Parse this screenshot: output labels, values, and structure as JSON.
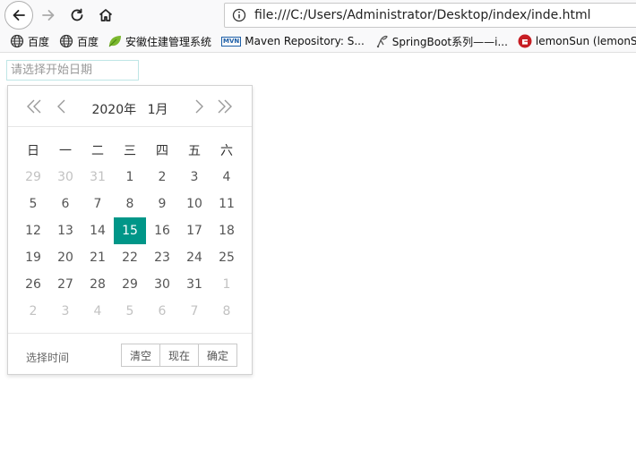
{
  "browser": {
    "url": "file:///C:/Users/Administrator/Desktop/index/inde.html"
  },
  "bookmarks": [
    {
      "label": "百度",
      "icon": "globe-icon"
    },
    {
      "label": "百度",
      "icon": "globe-icon"
    },
    {
      "label": "安徽住建管理系统",
      "icon": "leaf-icon"
    },
    {
      "label": "Maven Repository: S...",
      "icon": "mvn-icon",
      "badge": "MVN"
    },
    {
      "label": "SpringBoot系列——i...",
      "icon": "spring-icon"
    },
    {
      "label": "lemonSun (lemonSun",
      "icon": "gitee-icon"
    }
  ],
  "date_input": {
    "placeholder": "请选择开始日期"
  },
  "datepicker": {
    "year": "2020年",
    "month": "1月",
    "weekdays": [
      "日",
      "一",
      "二",
      "三",
      "四",
      "五",
      "六"
    ],
    "weeks": [
      [
        {
          "d": "29",
          "o": true
        },
        {
          "d": "30",
          "o": true
        },
        {
          "d": "31",
          "o": true
        },
        {
          "d": "1"
        },
        {
          "d": "2"
        },
        {
          "d": "3"
        },
        {
          "d": "4"
        }
      ],
      [
        {
          "d": "5"
        },
        {
          "d": "6"
        },
        {
          "d": "7"
        },
        {
          "d": "8"
        },
        {
          "d": "9"
        },
        {
          "d": "10"
        },
        {
          "d": "11"
        }
      ],
      [
        {
          "d": "12"
        },
        {
          "d": "13"
        },
        {
          "d": "14"
        },
        {
          "d": "15",
          "sel": true
        },
        {
          "d": "16"
        },
        {
          "d": "17"
        },
        {
          "d": "18"
        }
      ],
      [
        {
          "d": "19"
        },
        {
          "d": "20"
        },
        {
          "d": "21"
        },
        {
          "d": "22"
        },
        {
          "d": "23"
        },
        {
          "d": "24"
        },
        {
          "d": "25"
        }
      ],
      [
        {
          "d": "26"
        },
        {
          "d": "27"
        },
        {
          "d": "28"
        },
        {
          "d": "29"
        },
        {
          "d": "30"
        },
        {
          "d": "31"
        },
        {
          "d": "1",
          "o": true
        }
      ],
      [
        {
          "d": "2",
          "o": true
        },
        {
          "d": "3",
          "o": true
        },
        {
          "d": "4",
          "o": true
        },
        {
          "d": "5",
          "o": true
        },
        {
          "d": "6",
          "o": true
        },
        {
          "d": "7",
          "o": true
        },
        {
          "d": "8",
          "o": true
        }
      ]
    ],
    "select_time_label": "选择时间",
    "buttons": {
      "clear": "清空",
      "now": "现在",
      "confirm": "确定"
    }
  },
  "colors": {
    "selected": "#009688",
    "other_month": "#c2c2c2"
  }
}
